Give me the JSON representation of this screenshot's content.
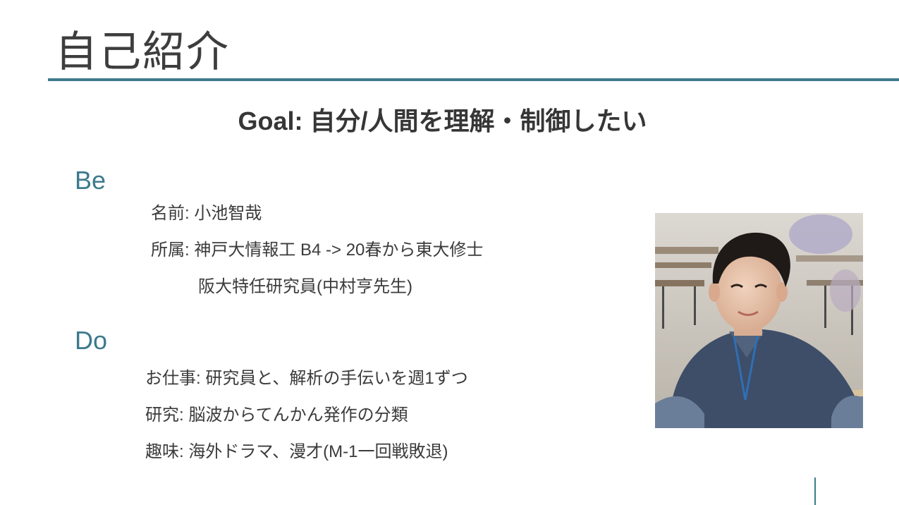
{
  "slide": {
    "title": "自己紹介",
    "goal": "Goal: 自分/人間を理解・制御したい"
  },
  "be": {
    "heading": "Be",
    "items": [
      "名前: 小池智哉",
      "所属: 神戸大情報工 B4 -> 20春から東大修士",
      "阪大特任研究員(中村亨先生)"
    ]
  },
  "do": {
    "heading": "Do",
    "items": [
      "お仕事: 研究員と、解析の手伝いを週1ずつ",
      "研究: 脳波からてんかん発作の分類",
      "趣味: 海外ドラマ、漫才(M-1一回戦敗退)"
    ]
  },
  "colors": {
    "accent": "#3d7a8c",
    "text": "#3b3b3b"
  }
}
